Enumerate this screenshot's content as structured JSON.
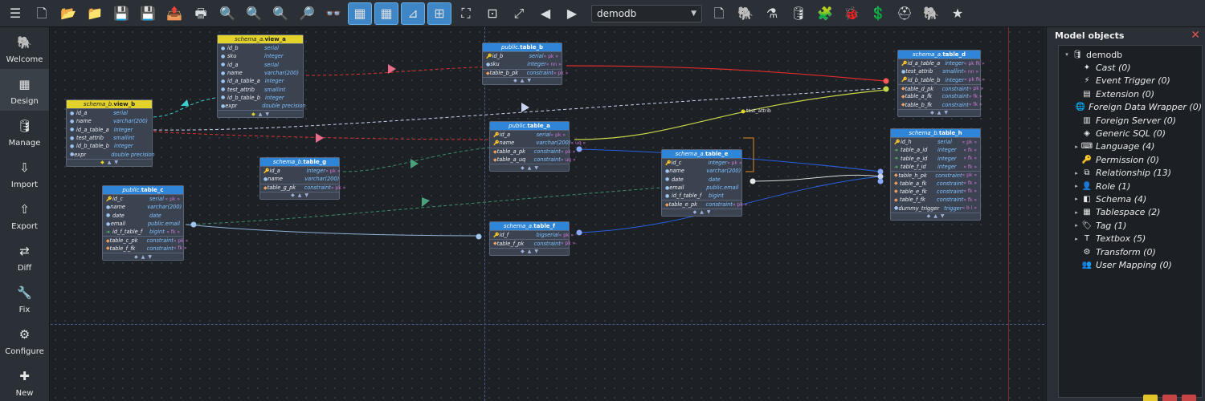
{
  "toolbar": {
    "db_selected": "demodb",
    "buttons": [
      {
        "name": "menu-icon",
        "glyph": "☰",
        "on": false
      },
      {
        "name": "new-model-icon",
        "glyph": "🗋",
        "on": false
      },
      {
        "name": "open-model-icon",
        "glyph": "📂",
        "on": false
      },
      {
        "name": "open-folder-icon",
        "glyph": "📁",
        "on": false
      },
      {
        "name": "save-icon",
        "glyph": "💾",
        "on": false
      },
      {
        "name": "save-as-icon",
        "glyph": "💾",
        "on": false
      },
      {
        "name": "export-icon",
        "glyph": "📤",
        "on": false
      },
      {
        "name": "print-icon",
        "glyph": "🖶",
        "on": false
      },
      {
        "name": "zoom-out-icon",
        "glyph": "🔍",
        "on": false
      },
      {
        "name": "zoom-reset-icon",
        "glyph": "🔍",
        "on": false
      },
      {
        "name": "zoom-in-icon",
        "glyph": "🔍",
        "on": false
      },
      {
        "name": "find-icon",
        "glyph": "🔎",
        "on": false
      },
      {
        "name": "binoculars-icon",
        "glyph": "👓",
        "on": false
      },
      {
        "name": "show-grid-icon",
        "glyph": "▦",
        "on": true
      },
      {
        "name": "align-grid-icon",
        "glyph": "▦",
        "on": true
      },
      {
        "name": "show-delimiters-icon",
        "glyph": "⊿",
        "on": true
      },
      {
        "name": "snap-icon",
        "glyph": "⊞",
        "on": true
      },
      {
        "name": "fit-view-icon",
        "glyph": "⛶",
        "on": false
      },
      {
        "name": "arrange-icon",
        "glyph": "⊡",
        "on": false
      },
      {
        "name": "expand-icon",
        "glyph": "⤢",
        "on": false
      },
      {
        "name": "back-icon",
        "glyph": "◀",
        "on": false
      },
      {
        "name": "forward-icon",
        "glyph": "▶",
        "on": false
      }
    ],
    "buttons_right": [
      {
        "name": "close-model-icon",
        "glyph": "🗋",
        "on": false
      },
      {
        "name": "plugins-icon",
        "glyph": "🐘",
        "on": false
      },
      {
        "name": "lab-icon",
        "glyph": "⚗",
        "on": false
      },
      {
        "name": "db-tools-icon",
        "glyph": "🛢",
        "on": false
      },
      {
        "name": "ci-icon",
        "glyph": "🧩",
        "on": false
      },
      {
        "name": "bug-report-icon",
        "glyph": "🐞",
        "on": false
      },
      {
        "name": "donate-icon",
        "glyph": "💲",
        "on": false
      },
      {
        "name": "support-icon",
        "glyph": "⛑",
        "on": false
      },
      {
        "name": "about-icon",
        "glyph": "🐘",
        "on": false
      },
      {
        "name": "new-version-icon",
        "glyph": "★",
        "on": false
      }
    ]
  },
  "sidebar": [
    {
      "name": "welcome",
      "label": "Welcome",
      "glyph": "🐘",
      "active": false
    },
    {
      "name": "design",
      "label": "Design",
      "glyph": "▦",
      "active": true
    },
    {
      "name": "manage",
      "label": "Manage",
      "glyph": "🛢",
      "active": false
    },
    {
      "name": "import",
      "label": "Import",
      "glyph": "⇩",
      "active": false
    },
    {
      "name": "export",
      "label": "Export",
      "glyph": "⇧",
      "active": false
    },
    {
      "name": "diff",
      "label": "Diff",
      "glyph": "⇄",
      "active": false
    },
    {
      "name": "fix",
      "label": "Fix",
      "glyph": "🔧",
      "active": false
    },
    {
      "name": "configure",
      "label": "Configure",
      "glyph": "⚙",
      "active": false
    },
    {
      "name": "new",
      "label": "New",
      "glyph": "✚",
      "active": false
    }
  ],
  "tables": [
    {
      "id": "view_a",
      "kind": "view",
      "schema": "schema_a",
      "name": "view_a",
      "rows": [
        {
          "k": "c",
          "n": "id_b",
          "t": "serial",
          "f": ""
        },
        {
          "k": "c",
          "n": "sku",
          "t": "integer",
          "f": ""
        },
        {
          "k": "c",
          "n": "id_a",
          "t": "serial",
          "f": ""
        },
        {
          "k": "c",
          "n": "name",
          "t": "varchar(200)",
          "f": ""
        },
        {
          "k": "c",
          "n": "id_a_table_a",
          "t": "integer",
          "f": ""
        },
        {
          "k": "c",
          "n": "test_attrib",
          "t": "smallint",
          "f": ""
        },
        {
          "k": "c",
          "n": "id_b_table_b",
          "t": "integer",
          "f": ""
        },
        {
          "k": "c",
          "n": "expr",
          "t": "double precision",
          "f": ""
        }
      ]
    },
    {
      "id": "view_b",
      "kind": "view",
      "schema": "schema_b",
      "name": "view_b",
      "rows": [
        {
          "k": "c",
          "n": "id_a",
          "t": "serial",
          "f": ""
        },
        {
          "k": "c",
          "n": "name",
          "t": "varchar(200)",
          "f": ""
        },
        {
          "k": "c",
          "n": "id_a_table_a",
          "t": "integer",
          "f": ""
        },
        {
          "k": "c",
          "n": "test_attrib",
          "t": "smallint",
          "f": ""
        },
        {
          "k": "c",
          "n": "id_b_table_b",
          "t": "integer",
          "f": ""
        },
        {
          "k": "c",
          "n": "expr",
          "t": "double precision",
          "f": ""
        }
      ]
    },
    {
      "id": "table_b",
      "kind": "table",
      "schema": "public",
      "name": "table_b",
      "rows": [
        {
          "k": "pk",
          "n": "id_b",
          "t": "serial",
          "f": "« pk »"
        },
        {
          "k": "c",
          "n": "sku",
          "t": "integer",
          "f": "« nn »"
        },
        {
          "k": "key2",
          "n": "table_b_pk",
          "t": "constraint",
          "f": "« pk »",
          "sep": true
        }
      ]
    },
    {
      "id": "table_a",
      "kind": "table",
      "schema": "public",
      "name": "table_a",
      "rows": [
        {
          "k": "pk",
          "n": "id_a",
          "t": "serial",
          "f": "« pk »"
        },
        {
          "k": "pk",
          "n": "name",
          "t": "varchar(200)",
          "f": "« uq »"
        },
        {
          "k": "key2",
          "n": "table_a_pk",
          "t": "constraint",
          "f": "« pk »",
          "sep": true
        },
        {
          "k": "key2",
          "n": "table_a_uq",
          "t": "constraint",
          "f": "« uq »"
        }
      ]
    },
    {
      "id": "table_g",
      "kind": "table",
      "schema": "schema_b",
      "name": "table_g",
      "rows": [
        {
          "k": "pk",
          "n": "id_a",
          "t": "integer",
          "f": "« pk »"
        },
        {
          "k": "c",
          "n": "name",
          "t": "varchar(200)",
          "f": ""
        },
        {
          "k": "key2",
          "n": "table_g_pk",
          "t": "constraint",
          "f": "« pk »",
          "sep": true
        }
      ]
    },
    {
      "id": "table_c",
      "kind": "table",
      "schema": "public",
      "name": "table_c",
      "rows": [
        {
          "k": "pk",
          "n": "id_c",
          "t": "serial",
          "f": "« pk »"
        },
        {
          "k": "c",
          "n": "name",
          "t": "varchar(200)",
          "f": ""
        },
        {
          "k": "c",
          "n": "date",
          "t": "date",
          "f": ""
        },
        {
          "k": "c",
          "n": "email",
          "t": "public.email",
          "f": ""
        },
        {
          "k": "fk",
          "n": "id_f_table_f",
          "t": "bigint",
          "f": "« fk »"
        },
        {
          "k": "key2",
          "n": "table_c_pk",
          "t": "constraint",
          "f": "« pk »",
          "sep": true
        },
        {
          "k": "key2",
          "n": "table_f_fk",
          "t": "constraint",
          "f": "« fk »"
        }
      ]
    },
    {
      "id": "table_f",
      "kind": "table",
      "schema": "schema_a",
      "name": "table_f",
      "rows": [
        {
          "k": "pk",
          "n": "id_f",
          "t": "bigserial",
          "f": "« pk »"
        },
        {
          "k": "key2",
          "n": "table_f_pk",
          "t": "constraint",
          "f": "« pk »",
          "sep": true
        }
      ]
    },
    {
      "id": "table_e",
      "kind": "table",
      "schema": "schema_a",
      "name": "table_e",
      "rows": [
        {
          "k": "pk",
          "n": "id_c",
          "t": "integer",
          "f": "« pk »"
        },
        {
          "k": "c",
          "n": "name",
          "t": "varchar(200)",
          "f": ""
        },
        {
          "k": "c",
          "n": "date",
          "t": "date",
          "f": ""
        },
        {
          "k": "c",
          "n": "email",
          "t": "public.email",
          "f": ""
        },
        {
          "k": "c",
          "n": "id_f_table_f",
          "t": "bigint",
          "f": ""
        },
        {
          "k": "key2",
          "n": "table_e_pk",
          "t": "constraint",
          "f": "« pk »",
          "sep": true
        }
      ]
    },
    {
      "id": "table_d",
      "kind": "table",
      "schema": "schema_a",
      "name": "table_d",
      "rows": [
        {
          "k": "pk",
          "n": "id_a_table_a",
          "t": "integer",
          "f": "« pk fk »"
        },
        {
          "k": "c",
          "n": "test_attrib",
          "t": "smallint",
          "f": "« nn »"
        },
        {
          "k": "pk",
          "n": "id_b_table_b",
          "t": "integer",
          "f": "« pk fk »"
        },
        {
          "k": "key2",
          "n": "table_d_pk",
          "t": "constraint",
          "f": "« pk »",
          "sep": true
        },
        {
          "k": "key2",
          "n": "table_a_fk",
          "t": "constraint",
          "f": "« fk »"
        },
        {
          "k": "key2",
          "n": "table_b_fk",
          "t": "constraint",
          "f": "« fk »"
        }
      ]
    },
    {
      "id": "table_h",
      "kind": "table",
      "schema": "schema_b",
      "name": "table_h",
      "rows": [
        {
          "k": "pk",
          "n": "id_h",
          "t": "serial",
          "f": "« pk »"
        },
        {
          "k": "fk",
          "n": "table_a_id",
          "t": "integer",
          "f": "« fk »"
        },
        {
          "k": "fk",
          "n": "table_e_id",
          "t": "integer",
          "f": "« fk »"
        },
        {
          "k": "fk",
          "n": "table_f_id",
          "t": "integer",
          "f": "« fk »"
        },
        {
          "k": "key2",
          "n": "table_h_pk",
          "t": "constraint",
          "f": "« pk »",
          "sep": true
        },
        {
          "k": "key2",
          "n": "table_a_fk",
          "t": "constraint",
          "f": "« fk »"
        },
        {
          "k": "key2",
          "n": "table_e_fk",
          "t": "constraint",
          "f": "« fk »"
        },
        {
          "k": "key2",
          "n": "table_f_fk",
          "t": "constraint",
          "f": "« fk »"
        },
        {
          "k": "c",
          "n": "dummy_trigger",
          "t": "trigger",
          "f": "« b i »"
        }
      ]
    }
  ],
  "canvas_label": "test_attrib",
  "panel": {
    "title": "Model objects",
    "root": "demodb",
    "items": [
      {
        "name": "cast",
        "label": "Cast (0)",
        "glyph": "✦",
        "expandable": false
      },
      {
        "name": "event-trigger",
        "label": "Event Trigger (0)",
        "glyph": "⚡",
        "expandable": false
      },
      {
        "name": "extension",
        "label": "Extension (0)",
        "glyph": "▤",
        "expandable": false
      },
      {
        "name": "foreign-data-wrapper",
        "label": "Foreign Data Wrapper (0)",
        "glyph": "🌐",
        "expandable": false
      },
      {
        "name": "foreign-server",
        "label": "Foreign Server (0)",
        "glyph": "▥",
        "expandable": false
      },
      {
        "name": "generic-sql",
        "label": "Generic SQL (0)",
        "glyph": "◈",
        "expandable": false
      },
      {
        "name": "language",
        "label": "Language (4)",
        "glyph": "⌨",
        "expandable": true
      },
      {
        "name": "permission",
        "label": "Permission (0)",
        "glyph": "🔑",
        "expandable": false
      },
      {
        "name": "relationship",
        "label": "Relationship (13)",
        "glyph": "⧉",
        "expandable": true
      },
      {
        "name": "role",
        "label": "Role (1)",
        "glyph": "👤",
        "expandable": true
      },
      {
        "name": "schema",
        "label": "Schema (4)",
        "glyph": "◧",
        "expandable": true
      },
      {
        "name": "tablespace",
        "label": "Tablespace (2)",
        "glyph": "▦",
        "expandable": true
      },
      {
        "name": "tag",
        "label": "Tag (1)",
        "glyph": "🏷",
        "expandable": true
      },
      {
        "name": "textbox",
        "label": "Textbox (5)",
        "glyph": "T",
        "expandable": true
      },
      {
        "name": "transform",
        "label": "Transform (0)",
        "glyph": "⚙",
        "expandable": false
      },
      {
        "name": "user-mapping",
        "label": "User Mapping (0)",
        "glyph": "👥",
        "expandable": false
      }
    ]
  }
}
